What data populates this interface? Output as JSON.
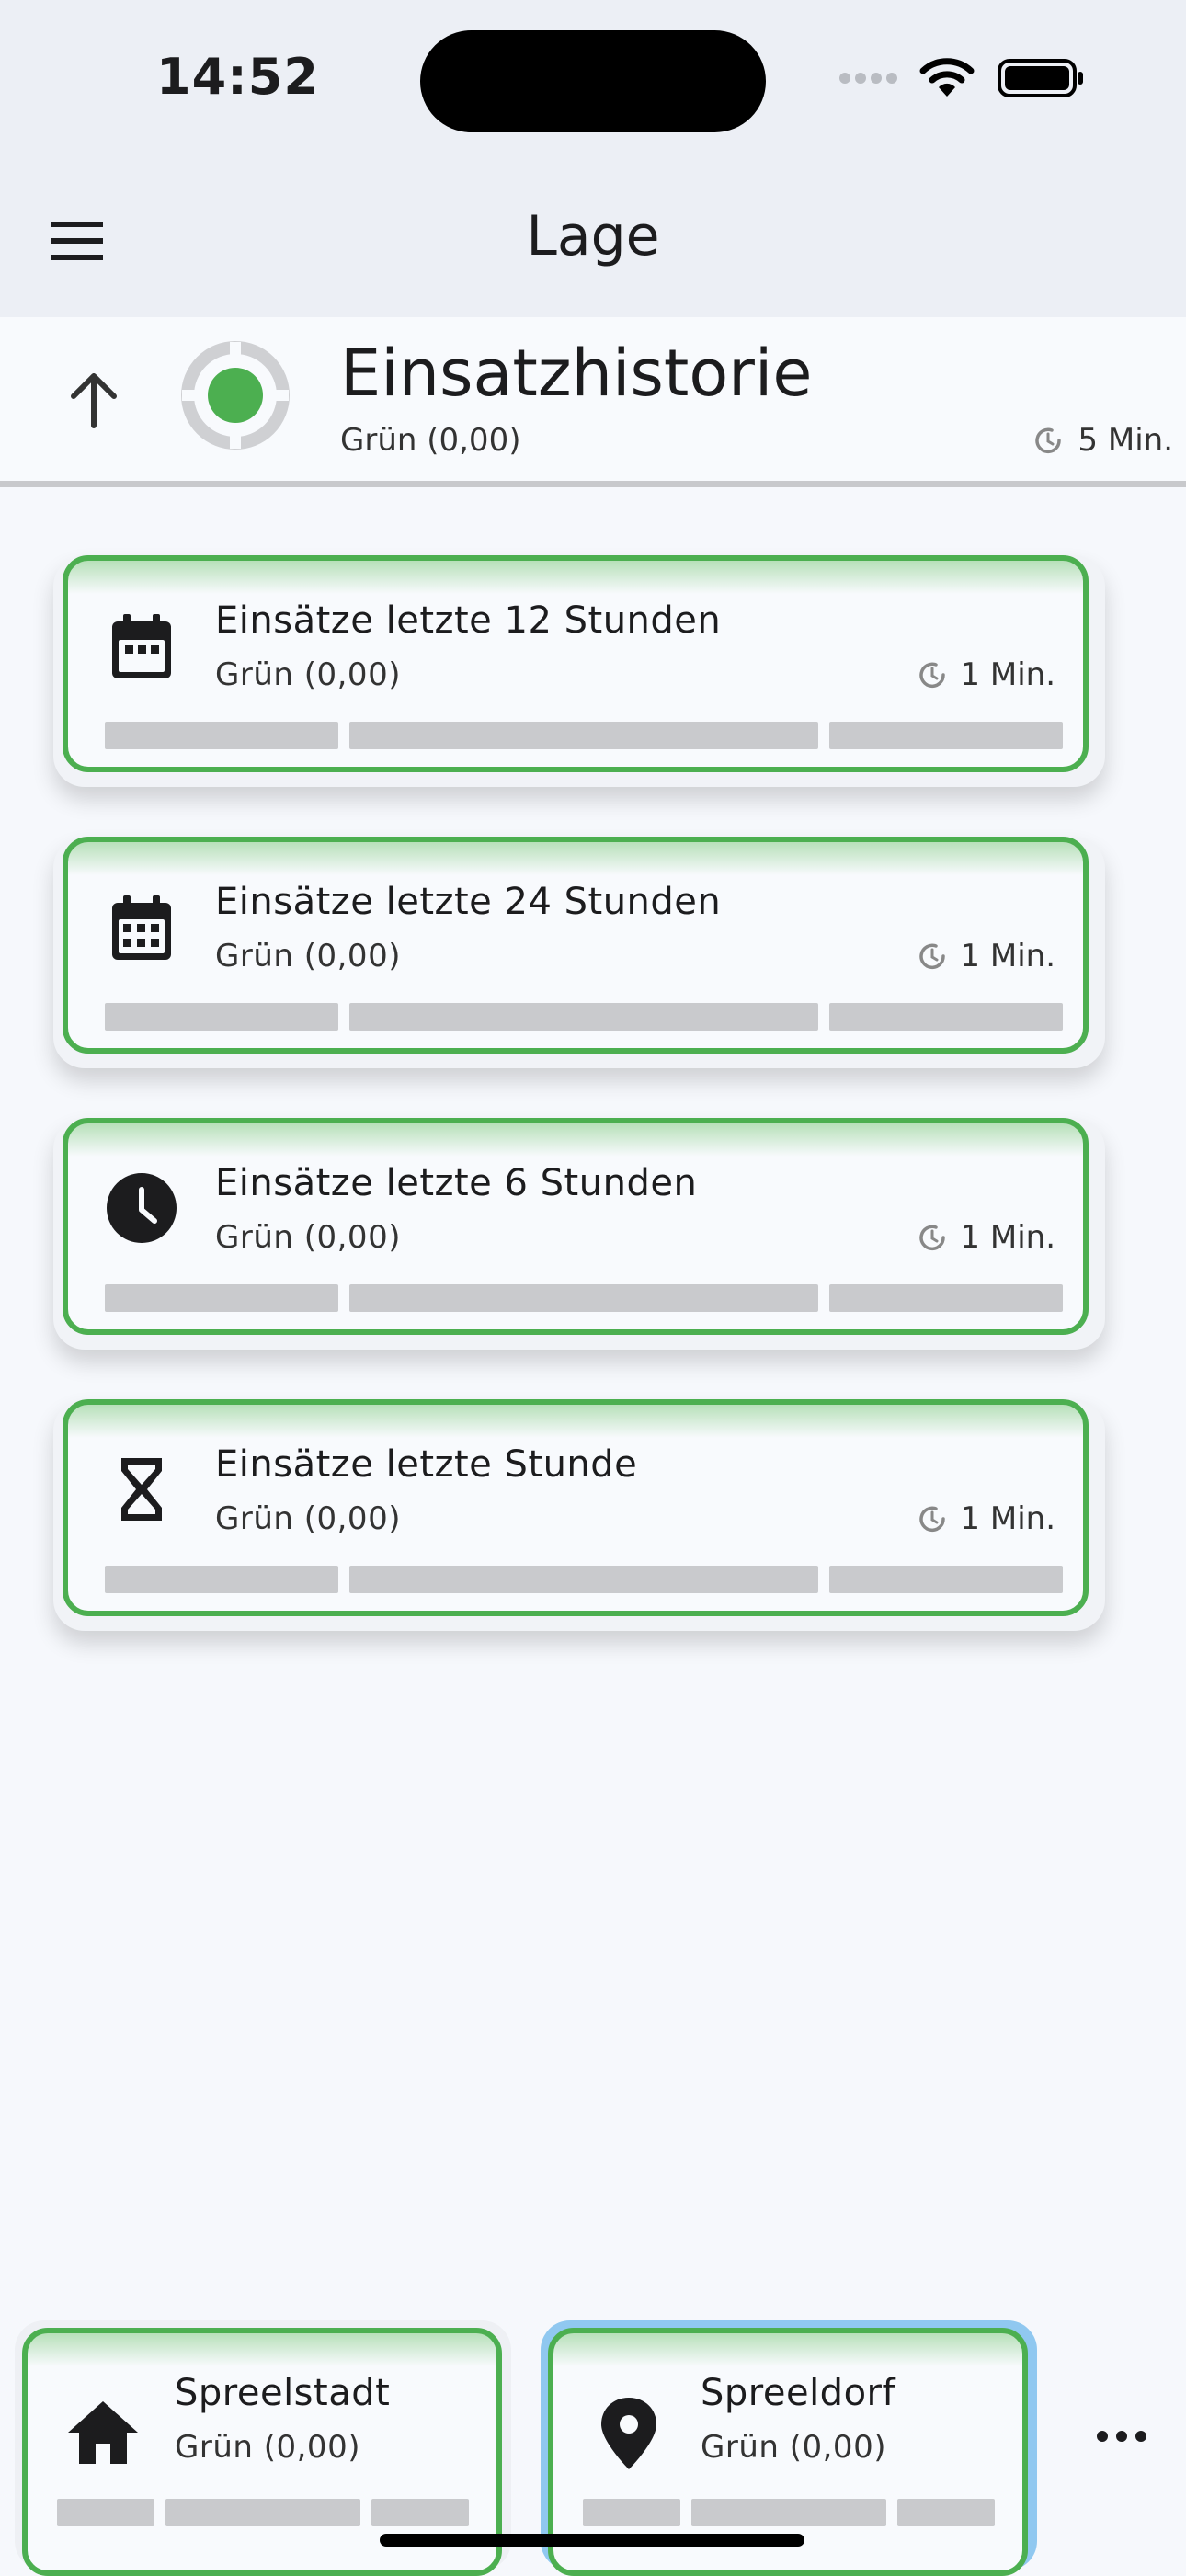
{
  "status_bar": {
    "time": "14:52"
  },
  "app_bar": {
    "title": "Lage"
  },
  "header": {
    "title": "Einsatzhistorie",
    "status": "Grün (0,00)",
    "age": "5 Min.",
    "status_color": "#4caf50"
  },
  "cards": [
    {
      "icon": "calendar-icon",
      "title": "Einsätze letzte 12 Stunden",
      "status": "Grün (0,00)",
      "age": "1 Min."
    },
    {
      "icon": "calendar-month-icon",
      "title": "Einsätze letzte 24 Stunden",
      "status": "Grün (0,00)",
      "age": "1 Min."
    },
    {
      "icon": "clock-icon",
      "title": "Einsätze letzte 6 Stunden",
      "status": "Grün (0,00)",
      "age": "1 Min."
    },
    {
      "icon": "hourglass-icon",
      "title": "Einsätze letzte Stunde",
      "status": "Grün (0,00)",
      "age": "1 Min."
    }
  ],
  "bottom_nav": [
    {
      "icon": "home-icon",
      "title": "Spreelstadt",
      "status": "Grün (0,00)",
      "selected": false
    },
    {
      "icon": "location-pin-icon",
      "title": "Spreeldorf",
      "status": "Grün (0,00)",
      "selected": true
    }
  ],
  "colors": {
    "accent_green": "#4caf50",
    "selected_outline": "#90c8f0",
    "bar_grey": "#c9cacd"
  }
}
